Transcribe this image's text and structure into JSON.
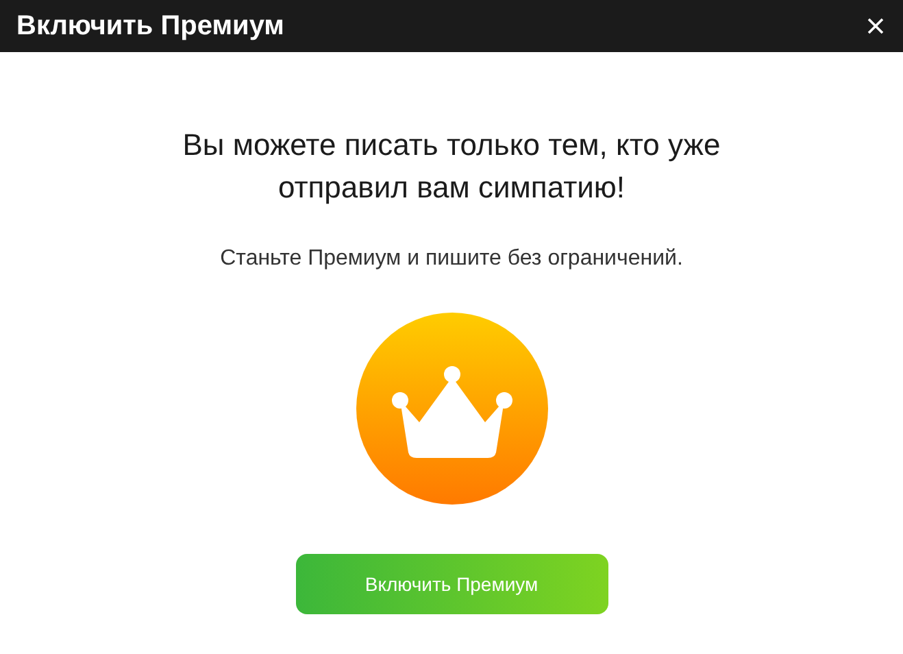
{
  "window": {
    "title": "Включить Премиум"
  },
  "dialog": {
    "heading": "Вы можете писать только тем, кто уже отправил вам симпатию!",
    "subtitle": "Станьте Премиум и пишите без ограничений.",
    "button": "Включить Премиум"
  }
}
